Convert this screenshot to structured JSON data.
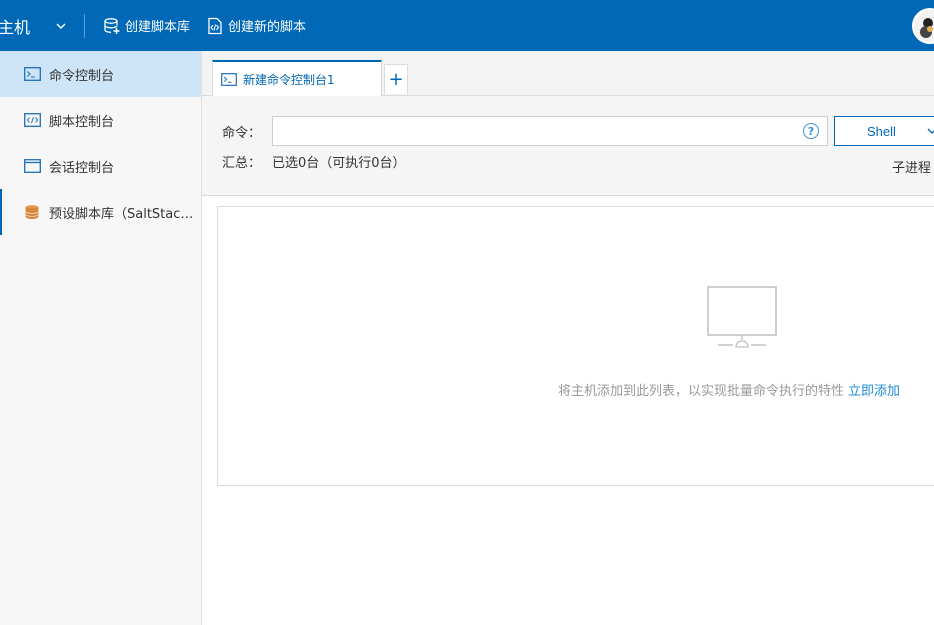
{
  "topbar": {
    "title": "主机",
    "create_library": "创建脚本库",
    "create_script": "创建新的脚本"
  },
  "sidebar": {
    "items": [
      {
        "label": "命令控制台",
        "icon": "terminal-icon"
      },
      {
        "label": "脚本控制台",
        "icon": "code-icon"
      },
      {
        "label": "会话控制台",
        "icon": "window-icon"
      },
      {
        "label": "预设脚本库（SaltStack）",
        "icon": "database-icon"
      }
    ]
  },
  "tabs": [
    {
      "label": "新建命令控制台1"
    }
  ],
  "tab_add": "+",
  "command": {
    "label": "命令：",
    "value": "",
    "placeholder": "",
    "help": "?",
    "shell": "Shell"
  },
  "summary": {
    "label": "汇总：",
    "value": "已选0台（可执行0台）",
    "subprocess": "子进程"
  },
  "empty": {
    "text": "将主机添加到此列表，以实现批量命令执行的特性",
    "link": "立即添加"
  },
  "colors": {
    "primary": "#0068b7",
    "active_bg": "#cde5f7",
    "link": "#1d8bd6"
  }
}
